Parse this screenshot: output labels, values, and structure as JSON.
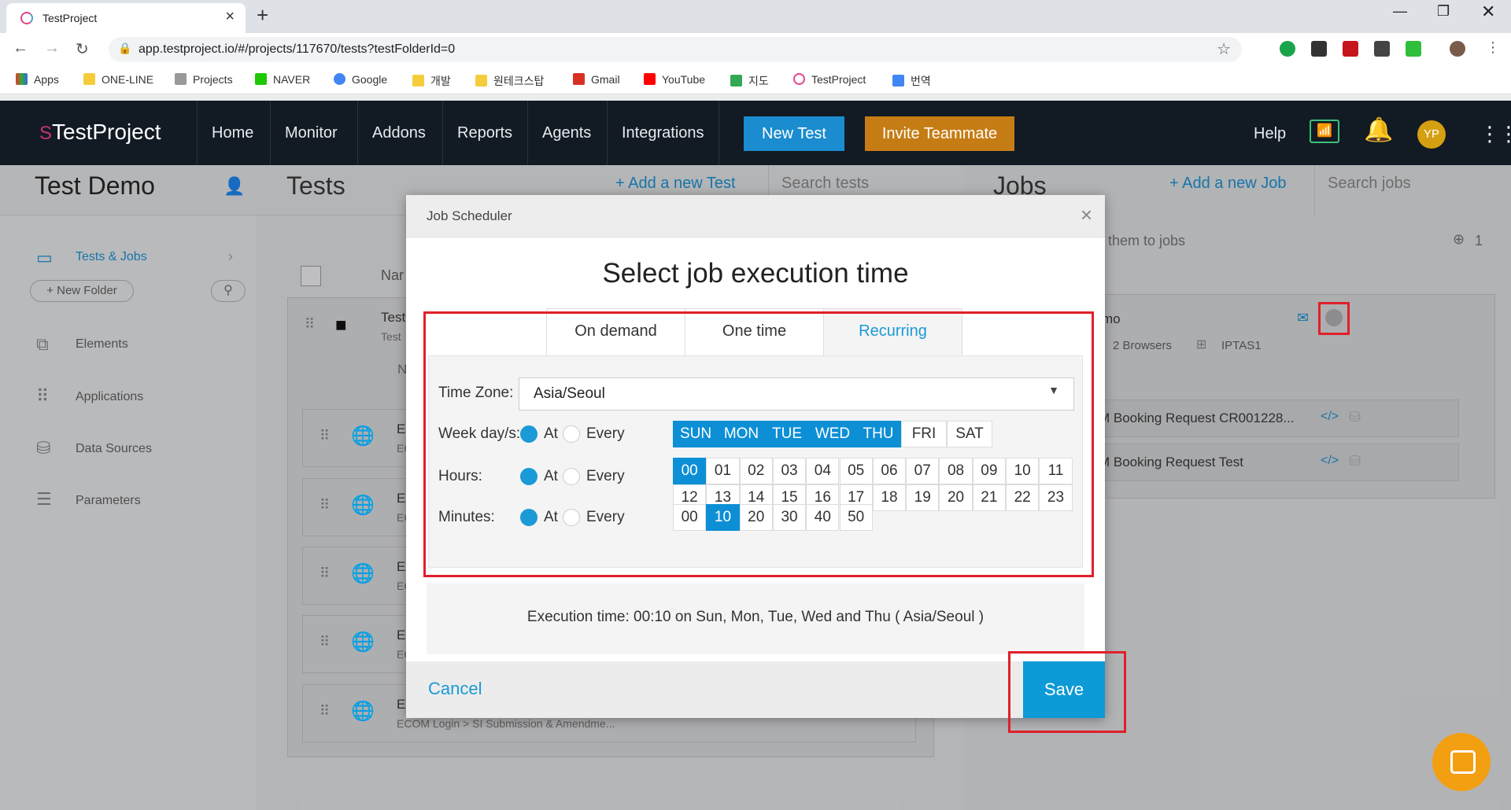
{
  "browser": {
    "tab_title": "TestProject",
    "url": "app.testproject.io/#/projects/117670/tests?testFolderId=0",
    "bookmarks": [
      "Apps",
      "ONE-LINE",
      "Projects",
      "NAVER",
      "Google",
      "개발",
      "원테크스탑",
      "Gmail",
      "YouTube",
      "지도",
      "TestProject",
      "번역"
    ]
  },
  "app": {
    "logo": "TestProject",
    "nav": [
      "Home",
      "Monitor",
      "Addons",
      "Reports",
      "Agents",
      "Integrations"
    ],
    "new_test": "New Test",
    "invite": "Invite Teammate",
    "help": "Help",
    "avatar": "YP"
  },
  "sidebar": {
    "project": "Test Demo",
    "tests_jobs": "Tests & Jobs",
    "new_folder": "+ New Folder",
    "items": [
      "Elements",
      "Applications",
      "Data Sources",
      "Parameters"
    ]
  },
  "tests": {
    "title": "Tests",
    "add": "+ Add a new Test",
    "search": "Search tests",
    "col_name": "Nar",
    "row_title": "Test",
    "row_sub": "Test",
    "row_n": "N",
    "items": [
      "E",
      "E",
      "E",
      "E",
      "E"
    ],
    "item_sub": [
      "EC",
      "EC",
      "EC",
      "EC",
      "ECOM Login > SI Submission & Amendme..."
    ]
  },
  "jobs": {
    "title": "Jobs",
    "add": "+ Add a new Job",
    "search": "Search jobs",
    "hint": "them to jobs",
    "globe_count": "1",
    "job_name": "mo",
    "browsers": "2 Browsers",
    "agent": "IPTAS1",
    "tests": [
      "M Booking Request CR001228...",
      "M Booking Request Test"
    ]
  },
  "modal": {
    "header": "Job Scheduler",
    "title": "Select job execution time",
    "tabs": [
      "On demand",
      "One time",
      "Recurring"
    ],
    "active_tab": "Recurring",
    "timezone_label": "Time Zone:",
    "timezone": "Asia/Seoul",
    "weekday_label": "Week day/s:",
    "hours_label": "Hours:",
    "minutes_label": "Minutes:",
    "at": "At",
    "every": "Every",
    "days": [
      {
        "label": "SUN",
        "selected": true
      },
      {
        "label": "MON",
        "selected": true
      },
      {
        "label": "TUE",
        "selected": true
      },
      {
        "label": "WED",
        "selected": true
      },
      {
        "label": "THU",
        "selected": true
      },
      {
        "label": "FRI",
        "selected": false
      },
      {
        "label": "SAT",
        "selected": false
      }
    ],
    "hours": [
      "00",
      "01",
      "02",
      "03",
      "04",
      "05",
      "06",
      "07",
      "08",
      "09",
      "10",
      "11",
      "12",
      "13",
      "14",
      "15",
      "16",
      "17",
      "18",
      "19",
      "20",
      "21",
      "22",
      "23"
    ],
    "selected_hour": "00",
    "minutes": [
      "00",
      "10",
      "20",
      "30",
      "40",
      "50"
    ],
    "selected_minute": "10",
    "execution_time": "Execution time: 00:10 on Sun, Mon, Tue, Wed and Thu ( Asia/Seoul )",
    "cancel": "Cancel",
    "save": "Save"
  },
  "colors": {
    "accent": "#0d9ad6",
    "highlight": "#e0202a",
    "invite": "#c67c14"
  }
}
